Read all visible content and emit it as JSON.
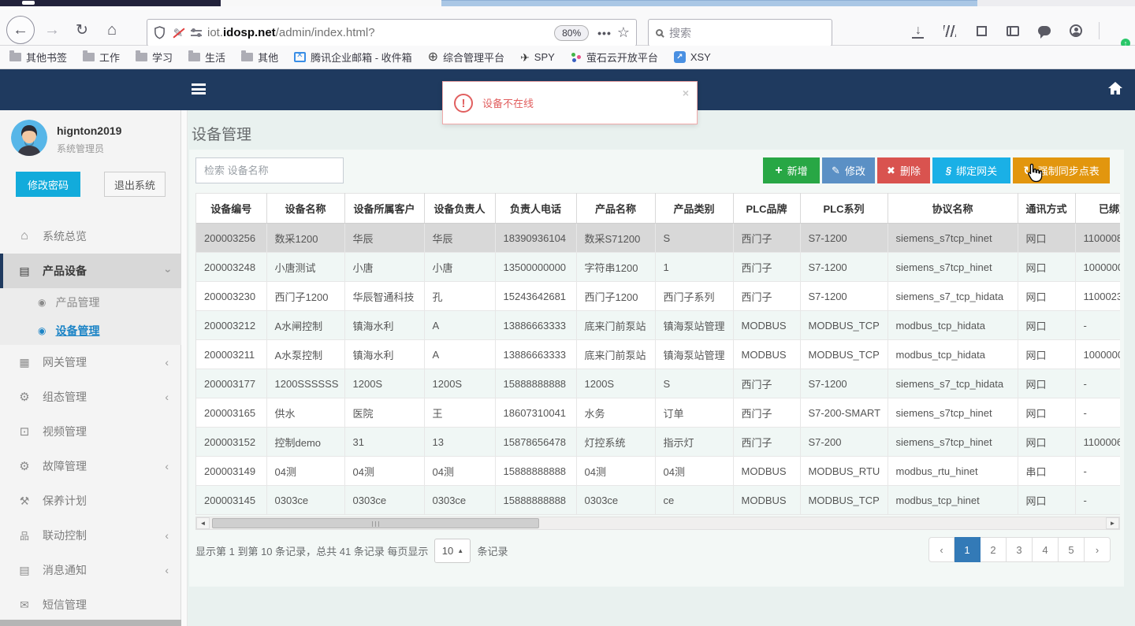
{
  "browser": {
    "url": {
      "prefix": "iot.",
      "domain": "idosp.net",
      "path": "/admin/index.html?"
    },
    "zoom_badge": "80%",
    "more_dots": "•••",
    "star": "☆",
    "back": "←",
    "forward": "→",
    "reload": "↻",
    "home": "⌂",
    "search_placeholder": "搜索",
    "bookmarks": [
      {
        "label": "其他书签",
        "icon": "folder-icon"
      },
      {
        "label": "工作",
        "icon": "folder-icon"
      },
      {
        "label": "学习",
        "icon": "folder-icon"
      },
      {
        "label": "生活",
        "icon": "folder-icon"
      },
      {
        "label": "其他",
        "icon": "folder-icon"
      },
      {
        "label": "腾讯企业邮箱 - 收件箱",
        "icon": "tencent-mail-icon"
      },
      {
        "label": "综合管理平台",
        "icon": "globe-icon"
      },
      {
        "label": "SPY",
        "icon": "plane-icon"
      },
      {
        "label": "萤石云开放平台",
        "icon": "color-dots-icon"
      },
      {
        "label": "XSY",
        "icon": "arrow-app-icon"
      }
    ],
    "globe_glyph": "⊕",
    "plane_glyph": "✈",
    "xsy_glyph": "↗"
  },
  "alert": {
    "message": "设备不在线",
    "close_label": "×"
  },
  "sidebar": {
    "username": "hignton2019",
    "role": "系统管理员",
    "change_password_label": "修改密码",
    "logout_label": "退出系统",
    "menu": [
      {
        "label": "系统总览",
        "icon": "home-icon"
      },
      {
        "label": "产品设备",
        "icon": "book-icon",
        "state": "expanded-active"
      },
      {
        "label": "产品管理",
        "icon": "dot-circle-icon",
        "submenu": true
      },
      {
        "label": "设备管理",
        "icon": "dot-circle-icon",
        "submenu": true,
        "state": "active"
      },
      {
        "label": "网关管理",
        "icon": "video-icon",
        "collapsed": true
      },
      {
        "label": "组态管理",
        "icon": "gears-icon",
        "collapsed": true
      },
      {
        "label": "视频管理",
        "icon": "monitor-icon"
      },
      {
        "label": "故障管理",
        "icon": "gears-icon",
        "collapsed": true
      },
      {
        "label": "保养计划",
        "icon": "wrench-icon"
      },
      {
        "label": "联动控制",
        "icon": "sitemap-icon",
        "collapsed": true
      },
      {
        "label": "消息通知",
        "icon": "book-icon",
        "collapsed": true
      },
      {
        "label": "短信管理",
        "icon": "envelope-icon"
      }
    ]
  },
  "page": {
    "title": "设备管理",
    "search_placeholder": "检索 设备名称",
    "buttons": [
      {
        "label": "新增",
        "icon": "plus-icon",
        "color": "#28a745"
      },
      {
        "label": "修改",
        "icon": "pencil-icon",
        "color": "#5b90c5"
      },
      {
        "label": "删除",
        "icon": "x-icon",
        "color": "#d9534f"
      },
      {
        "label": "绑定网关",
        "icon": "link-icon",
        "color": "#1ab0e6"
      },
      {
        "label": "强制同步点表",
        "icon": "sync-icon",
        "color": "#e2960e"
      }
    ]
  },
  "table": {
    "columns": [
      "设备编号",
      "设备名称",
      "设备所属客户",
      "设备负责人",
      "负责人电话",
      "产品名称",
      "产品类别",
      "PLC品牌",
      "PLC系列",
      "协议名称",
      "通讯方式",
      "已绑定网关"
    ],
    "rows": [
      [
        "200003256",
        "数采1200",
        "华辰",
        "华辰",
        "18390936104",
        "数采S71200",
        "S",
        "西门子",
        "S7-1200",
        "siemens_s7tcp_hinet",
        "网口",
        "1100008"
      ],
      [
        "200003248",
        "小唐测试",
        "小唐",
        "小唐",
        "13500000000",
        "字符串1200",
        "1",
        "西门子",
        "S7-1200",
        "siemens_s7tcp_hinet",
        "网口",
        "1000000"
      ],
      [
        "200003230",
        "西门子1200",
        "华辰智通科技",
        "孔",
        "15243642681",
        "西门子1200",
        "西门子系列",
        "西门子",
        "S7-1200",
        "siemens_s7_tcp_hidata",
        "网口",
        "1100023"
      ],
      [
        "200003212",
        "A水闸控制",
        "镇海水利",
        "A",
        "13886663333",
        "底来门前泵站",
        "镇海泵站管理",
        "MODBUS",
        "MODBUS_TCP",
        "modbus_tcp_hidata",
        "网口",
        "-"
      ],
      [
        "200003211",
        "A水泵控制",
        "镇海水利",
        "A",
        "13886663333",
        "底来门前泵站",
        "镇海泵站管理",
        "MODBUS",
        "MODBUS_TCP",
        "modbus_tcp_hidata",
        "网口",
        "1000000"
      ],
      [
        "200003177",
        "1200SSSSSS",
        "1200S",
        "1200S",
        "15888888888",
        "1200S",
        "S",
        "西门子",
        "S7-1200",
        "siemens_s7_tcp_hidata",
        "网口",
        "-"
      ],
      [
        "200003165",
        "供水",
        "医院",
        "王",
        "18607310041",
        "水务",
        "订单",
        "西门子",
        "S7-200-SMART",
        "siemens_s7tcp_hinet",
        "网口",
        "-"
      ],
      [
        "200003152",
        "控制demo",
        "31",
        "13",
        "15878656478",
        "灯控系统",
        "指示灯",
        "西门子",
        "S7-200",
        "siemens_s7tcp_hinet",
        "网口",
        "1100006"
      ],
      [
        "200003149",
        "04测",
        "04测",
        "04测",
        "15888888888",
        "04测",
        "04测",
        "MODBUS",
        "MODBUS_RTU",
        "modbus_rtu_hinet",
        "串口",
        "-"
      ],
      [
        "200003145",
        "0303ce",
        "0303ce",
        "0303ce",
        "15888888888",
        "0303ce",
        "ce",
        "MODBUS",
        "MODBUS_TCP",
        "modbus_tcp_hinet",
        "网口",
        "-"
      ]
    ]
  },
  "pagination": {
    "summary_prefix": "显示第 1 到第 10 条记录，总共 41 条记录 每页显示",
    "page_size": "10",
    "summary_suffix": "条记录",
    "prev": "‹",
    "next": "›",
    "pages": [
      "1",
      "2",
      "3",
      "4",
      "5"
    ],
    "active_page": "1"
  },
  "colors": {
    "navbar_blue": "#1f3a5f",
    "page_bg": "#e9f1ef",
    "selected_row": "#d8d8d8",
    "striped_row": "#f0f7f5",
    "pagination_active": "#337ab7",
    "sidebar_link_active": "#1c84c6",
    "alert_red": "#e15f5f"
  }
}
